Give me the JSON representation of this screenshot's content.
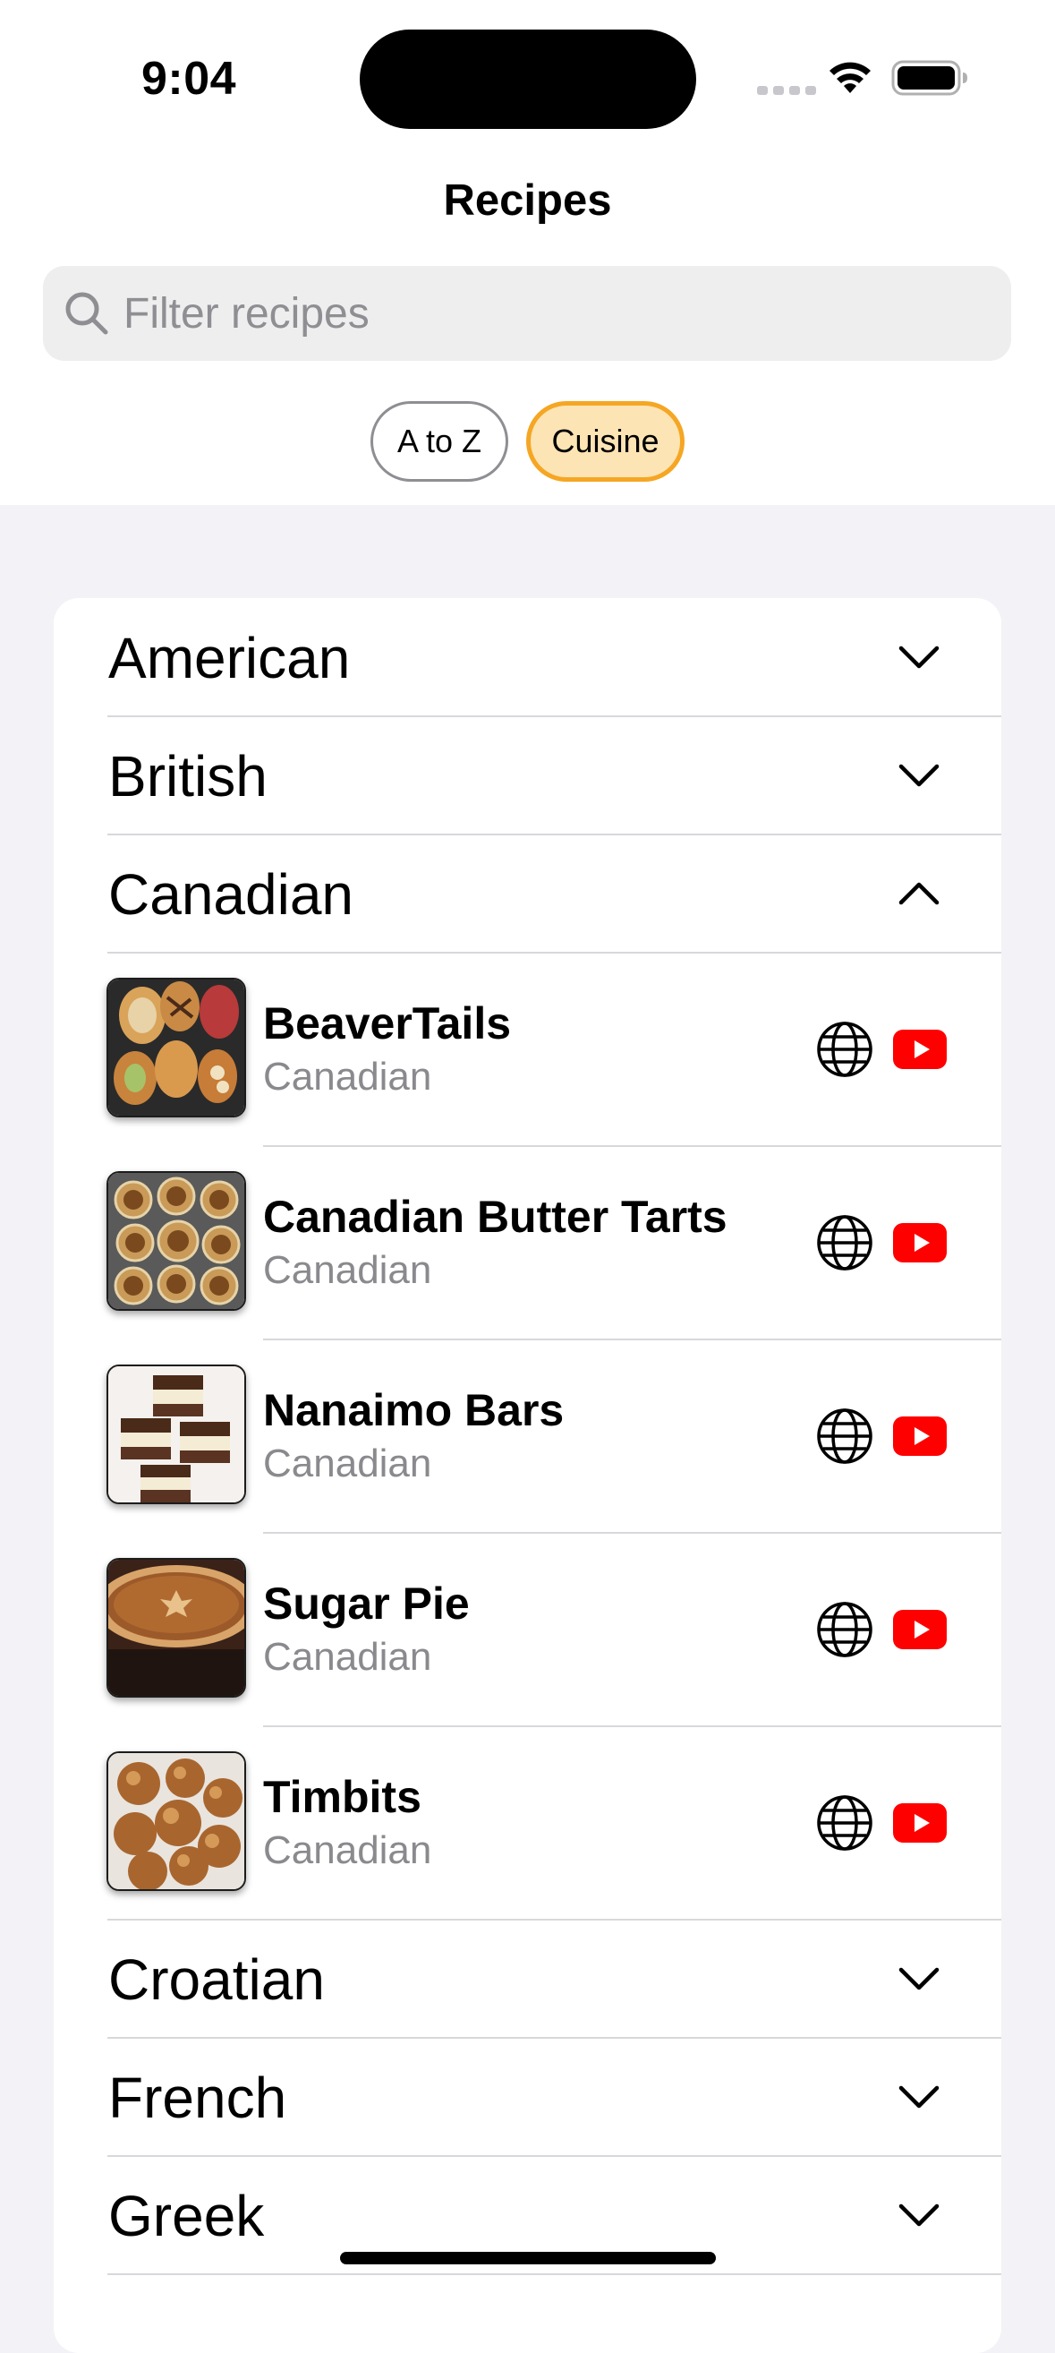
{
  "status_bar": {
    "time": "9:04"
  },
  "nav": {
    "title": "Recipes"
  },
  "search": {
    "placeholder": "Filter recipes"
  },
  "sort": {
    "options": [
      "A to Z",
      "Cuisine"
    ],
    "selected": "Cuisine"
  },
  "colors": {
    "accent": "#f5a623",
    "accent_fill": "#fde4b4",
    "youtube": "#ff0000",
    "group_bg": "#f2f2f7"
  },
  "sections": [
    {
      "label": "American",
      "expanded": false,
      "icon": "chevron-down-icon"
    },
    {
      "label": "British",
      "expanded": false,
      "icon": "chevron-down-icon"
    },
    {
      "label": "Canadian",
      "expanded": true,
      "icon": "chevron-up-icon"
    },
    {
      "label": "Croatian",
      "expanded": false,
      "icon": "chevron-down-icon"
    },
    {
      "label": "French",
      "expanded": false,
      "icon": "chevron-down-icon"
    },
    {
      "label": "Greek",
      "expanded": false,
      "icon": "chevron-down-icon"
    }
  ],
  "recipes": [
    {
      "name": "BeaverTails",
      "cuisine": "Canadian",
      "icons": [
        "globe-icon",
        "youtube-icon"
      ]
    },
    {
      "name": "Canadian Butter Tarts",
      "cuisine": "Canadian",
      "icons": [
        "globe-icon",
        "youtube-icon"
      ]
    },
    {
      "name": "Nanaimo Bars",
      "cuisine": "Canadian",
      "icons": [
        "globe-icon",
        "youtube-icon"
      ]
    },
    {
      "name": "Sugar Pie",
      "cuisine": "Canadian",
      "icons": [
        "globe-icon",
        "youtube-icon"
      ]
    },
    {
      "name": "Timbits",
      "cuisine": "Canadian",
      "icons": [
        "globe-icon",
        "youtube-icon"
      ]
    }
  ]
}
